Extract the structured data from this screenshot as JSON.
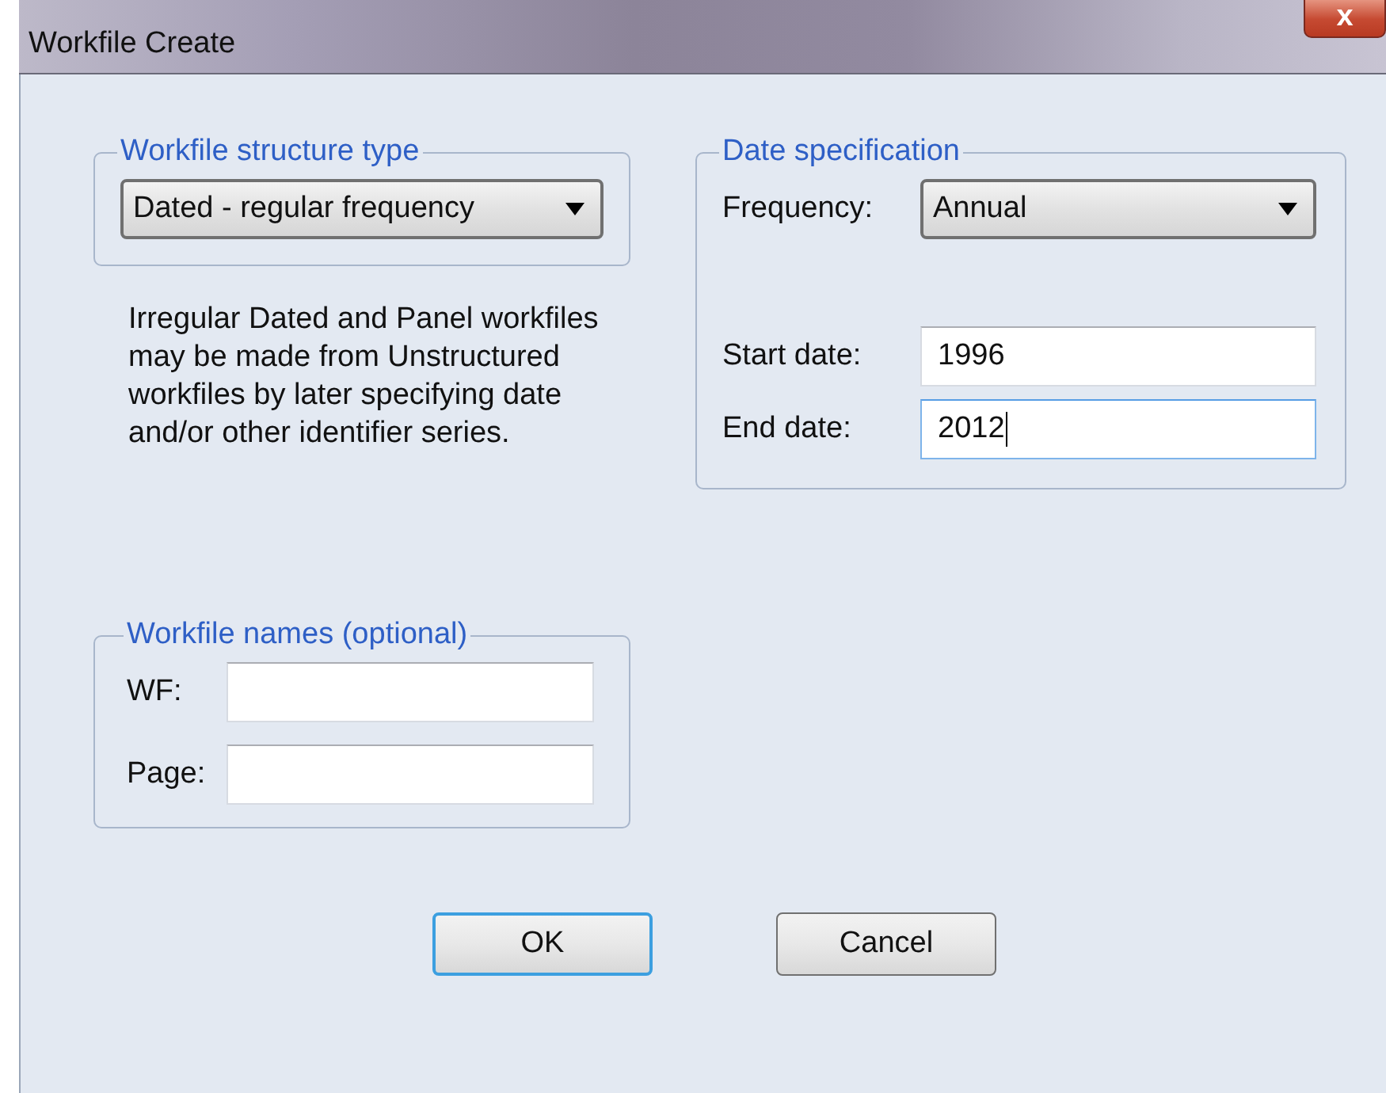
{
  "window": {
    "title": "Workfile Create",
    "close_symbol": "x"
  },
  "structure_group": {
    "title": "Workfile structure type",
    "dropdown": {
      "value": "Dated - regular frequency"
    }
  },
  "note": "Irregular Dated and Panel workfiles may be made from Unstructured workfiles by later specifying date and/or other identifier series.",
  "date_group": {
    "title": "Date specification",
    "frequency": {
      "label": "Frequency:",
      "value": "Annual"
    },
    "fields": [
      {
        "label": "Start date:",
        "value": "1996",
        "focused": false
      },
      {
        "label": "End date:",
        "value": "2012",
        "focused": true
      }
    ]
  },
  "names_group": {
    "title": "Workfile names (optional)",
    "fields": [
      {
        "label": "WF:",
        "focused": false
      },
      {
        "label": "Page:",
        "focused": false
      }
    ]
  },
  "buttons": [
    {
      "label": "OK",
      "default": true
    },
    {
      "label": "Cancel",
      "default": false
    }
  ]
}
